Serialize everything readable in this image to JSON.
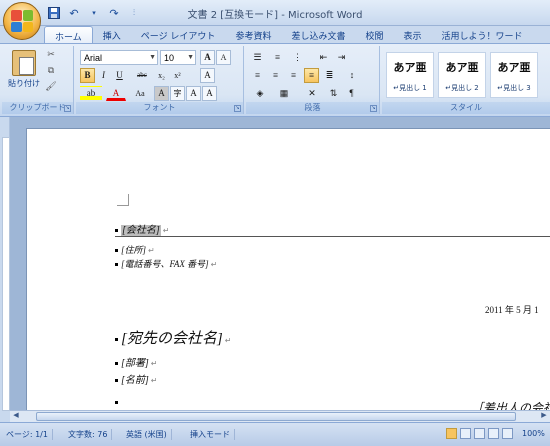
{
  "window": {
    "title": "文書 2 [互換モード] - Microsoft Word"
  },
  "qat": {
    "save_icon": "save-icon",
    "undo_icon": "undo-icon",
    "redo_icon": "redo-icon",
    "customize_icon": "customize-icon"
  },
  "tabs": [
    {
      "label": "ホーム"
    },
    {
      "label": "挿入"
    },
    {
      "label": "ページ レイアウト"
    },
    {
      "label": "参考資料"
    },
    {
      "label": "差し込み文書"
    },
    {
      "label": "校閲"
    },
    {
      "label": "表示"
    },
    {
      "label": "活用しよう！ワード"
    }
  ],
  "ribbon": {
    "clipboard": {
      "label": "クリップボード",
      "paste_label": "貼り付け"
    },
    "font": {
      "label": "フォント",
      "font_name": "Arial",
      "font_size": "10",
      "grow": "A",
      "shrink": "A",
      "clear": "A",
      "bold": "B",
      "italic": "I",
      "underline": "U",
      "strike": "abc",
      "sub": "x₂",
      "sup": "x²",
      "case": "Aa",
      "highlight": "ab",
      "color": "A",
      "aa": "Aa",
      "char_shade": "A",
      "enclose": "字",
      "ruby": "A",
      "phonetic": "A"
    },
    "paragraph": {
      "label": "段落"
    },
    "styles": {
      "label": "スタイル",
      "items": [
        {
          "preview": "あア亜",
          "name": "↵見出し 1"
        },
        {
          "preview": "あア亜",
          "name": "↵見出し 2"
        },
        {
          "preview": "あア亜",
          "name": "↵見出し 3"
        }
      ]
    }
  },
  "document": {
    "company": "[会社名]",
    "address": "[住所]",
    "phone": "[電話番号、FAX 番号]",
    "date": "2011 年 5 月 1",
    "recipient_company": "[宛先の会社名]",
    "department": "[部署]",
    "name": "[名前]",
    "sender_partial": "［差出人の会社"
  },
  "status": {
    "page": "ページ: 1/1",
    "words": "文字数: 76",
    "language": "英語 (米国)",
    "mode": "挿入モード",
    "zoom": "100%"
  },
  "colors": {
    "accent": "#15428b",
    "ribbon": "#dae6f4",
    "highlight": "#f7c45f"
  }
}
